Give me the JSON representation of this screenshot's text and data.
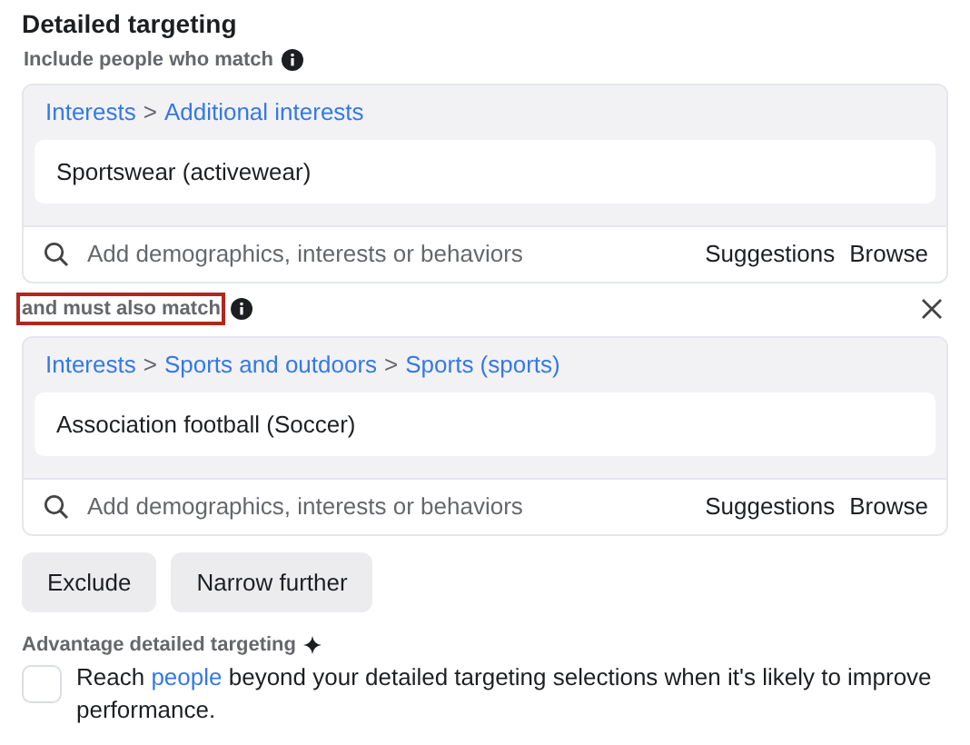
{
  "title": "Detailed targeting",
  "groups": [
    {
      "label": "Include people who match",
      "highlighted": false,
      "removable": false,
      "breadcrumb": [
        {
          "kind": "link",
          "text": "Interests"
        },
        {
          "kind": "separator",
          "text": ">"
        },
        {
          "kind": "link",
          "text": "Additional interests"
        }
      ],
      "items": [
        "Sportswear (activewear)"
      ],
      "search": {
        "placeholder": "Add demographics, interests or behaviors",
        "actions": [
          "Suggestions",
          "Browse"
        ]
      }
    },
    {
      "label": "and must also match",
      "highlighted": true,
      "removable": true,
      "breadcrumb": [
        {
          "kind": "link",
          "text": "Interests"
        },
        {
          "kind": "separator",
          "text": ">"
        },
        {
          "kind": "link",
          "text": "Sports and outdoors"
        },
        {
          "kind": "separator",
          "text": ">"
        },
        {
          "kind": "link",
          "text": "Sports (sports)"
        }
      ],
      "items": [
        "Association football (Soccer)"
      ],
      "search": {
        "placeholder": "Add demographics, interests or behaviors",
        "actions": [
          "Suggestions",
          "Browse"
        ]
      }
    }
  ],
  "buttons": [
    "Exclude",
    "Narrow further"
  ],
  "advantage": {
    "label": "Advantage detailed targeting",
    "checked": false,
    "text_before": "Reach ",
    "link": "people",
    "text_after": " beyond your detailed targeting selections when it's likely to improve performance."
  }
}
